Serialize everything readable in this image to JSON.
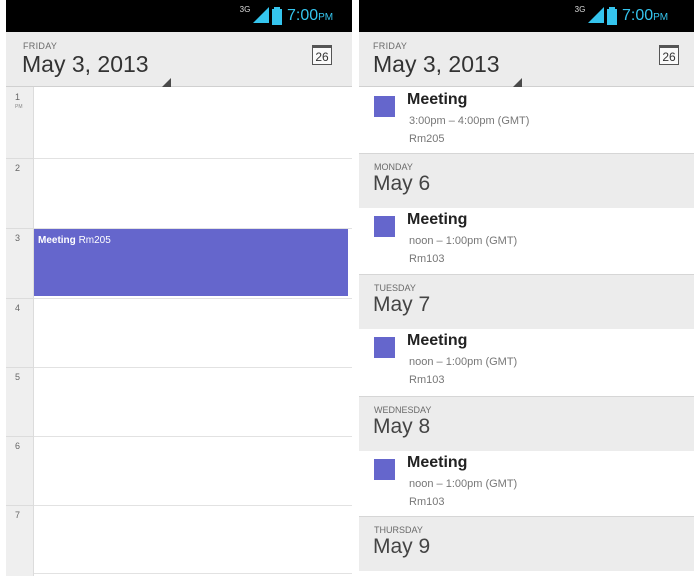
{
  "status_bar": {
    "network": "3G",
    "time": "7:00",
    "ampm": "PM"
  },
  "left_panel": {
    "header": {
      "day_of_week": "FRIDAY",
      "date": "May 3, 2013",
      "calendar_icon_day": "26"
    },
    "hours": [
      {
        "label": "1",
        "sub": "PM"
      },
      {
        "label": "2",
        "sub": ""
      },
      {
        "label": "3",
        "sub": ""
      },
      {
        "label": "4",
        "sub": ""
      },
      {
        "label": "5",
        "sub": ""
      },
      {
        "label": "6",
        "sub": ""
      },
      {
        "label": "7",
        "sub": ""
      }
    ],
    "event": {
      "title": "Meeting",
      "location": "Rm205"
    }
  },
  "right_panel": {
    "header": {
      "day_of_week": "FRIDAY",
      "date": "May 3, 2013",
      "calendar_icon_day": "26"
    },
    "days": [
      {
        "events": [
          {
            "title": "Meeting",
            "time": "3:00pm – 4:00pm (GMT)",
            "location": "Rm205"
          }
        ]
      },
      {
        "day_of_week": "MONDAY",
        "date": "May 6",
        "events": [
          {
            "title": "Meeting",
            "time": "noon – 1:00pm (GMT)",
            "location": "Rm103"
          }
        ]
      },
      {
        "day_of_week": "TUESDAY",
        "date": "May 7",
        "events": [
          {
            "title": "Meeting",
            "time": "noon – 1:00pm (GMT)",
            "location": "Rm103"
          }
        ]
      },
      {
        "day_of_week": "WEDNESDAY",
        "date": "May 8",
        "events": [
          {
            "title": "Meeting",
            "time": "noon – 1:00pm (GMT)",
            "location": "Rm103"
          }
        ]
      },
      {
        "day_of_week": "THURSDAY",
        "date": "May 9",
        "events": []
      }
    ]
  },
  "colors": {
    "event": "#6566cc",
    "status_time": "#35c5ee",
    "header_bg": "#ececec"
  }
}
